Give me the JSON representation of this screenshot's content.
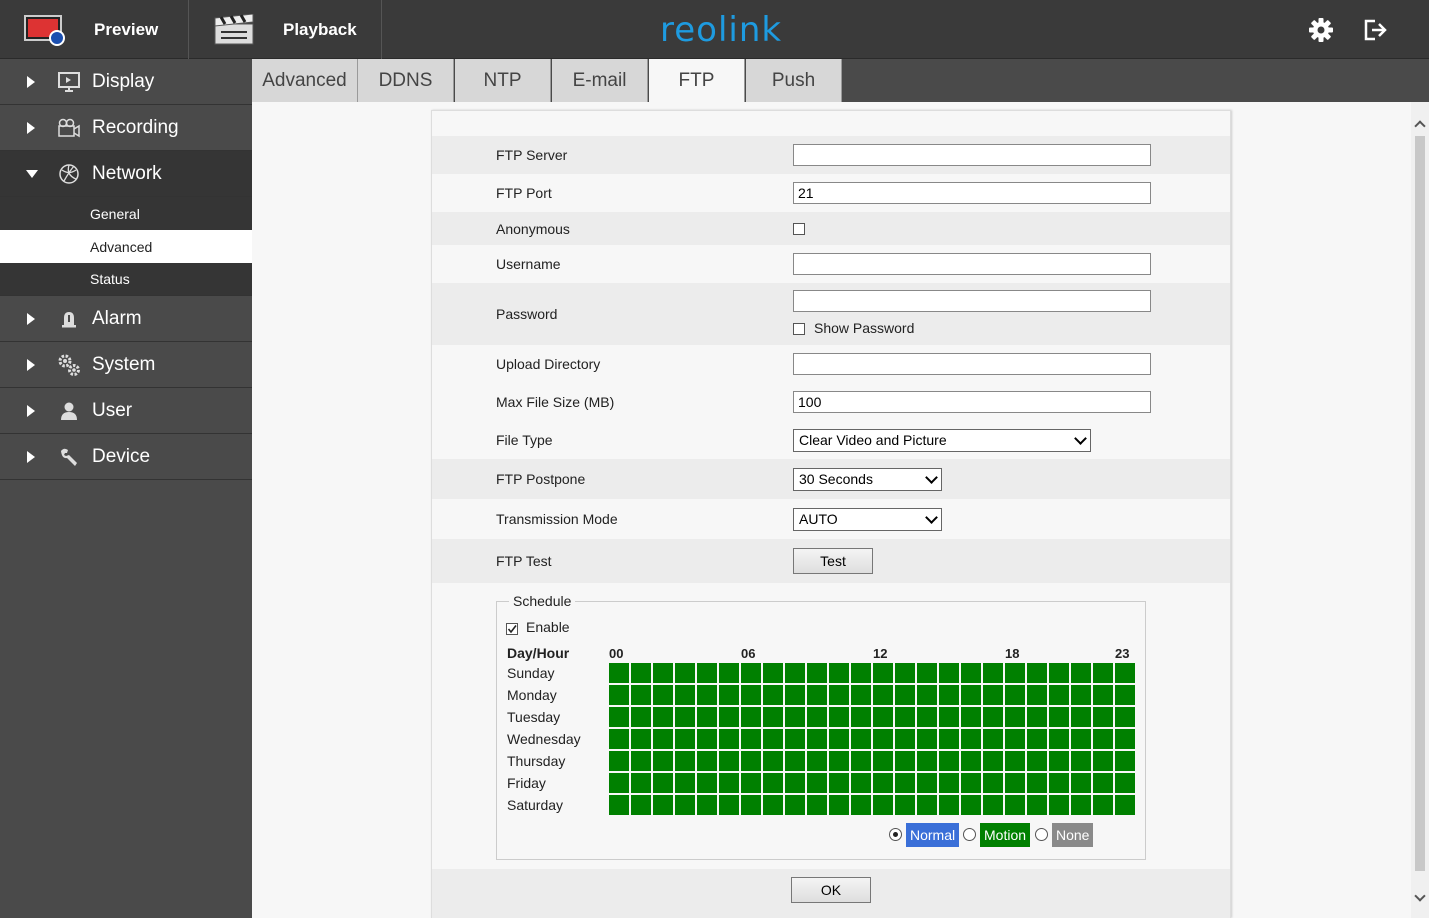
{
  "topbar": {
    "preview_label": "Preview",
    "playback_label": "Playback",
    "brand": "reolink"
  },
  "sidebar": {
    "items": [
      {
        "label": "Display",
        "icon": "monitor-icon"
      },
      {
        "label": "Recording",
        "icon": "camera-icon"
      },
      {
        "label": "Network",
        "icon": "network-icon"
      },
      {
        "label": "Alarm",
        "icon": "alarm-icon"
      },
      {
        "label": "System",
        "icon": "gears-icon"
      },
      {
        "label": "User",
        "icon": "user-icon"
      },
      {
        "label": "Device",
        "icon": "wrench-icon"
      }
    ],
    "network_sub": [
      "General",
      "Advanced",
      "Status"
    ]
  },
  "tabs": [
    "Advanced",
    "DDNS",
    "NTP",
    "E-mail",
    "FTP",
    "Push"
  ],
  "form": {
    "ftp_server": {
      "label": "FTP Server",
      "value": ""
    },
    "ftp_port": {
      "label": "FTP Port",
      "value": "21"
    },
    "anonymous": {
      "label": "Anonymous",
      "checked": false
    },
    "username": {
      "label": "Username",
      "value": ""
    },
    "password": {
      "label": "Password",
      "value": "",
      "show_label": "Show Password"
    },
    "upload_dir": {
      "label": "Upload Directory",
      "value": ""
    },
    "max_size": {
      "label": "Max File Size (MB)",
      "value": "100"
    },
    "file_type": {
      "label": "File Type",
      "value": "Clear Video and Picture"
    },
    "postpone": {
      "label": "FTP Postpone",
      "value": "30 Seconds"
    },
    "trans_mode": {
      "label": "Transmission Mode",
      "value": "AUTO"
    },
    "ftp_test": {
      "label": "FTP Test",
      "button": "Test"
    }
  },
  "schedule": {
    "legend": "Schedule",
    "enable_label": "Enable",
    "enabled": true,
    "header": "Day/Hour",
    "hour_marks": [
      "00",
      "06",
      "12",
      "18",
      "23"
    ],
    "days": [
      "Sunday",
      "Monday",
      "Tuesday",
      "Wednesday",
      "Thursday",
      "Friday",
      "Saturday"
    ],
    "hours_per_day": 24,
    "cell_color": "#008000",
    "modes": [
      {
        "label": "Normal",
        "color": "#3a6fd8",
        "selected": true
      },
      {
        "label": "Motion",
        "color": "#008000",
        "selected": false
      },
      {
        "label": "None",
        "color": "#8a8a8a",
        "selected": false
      }
    ]
  },
  "ok_label": "OK"
}
